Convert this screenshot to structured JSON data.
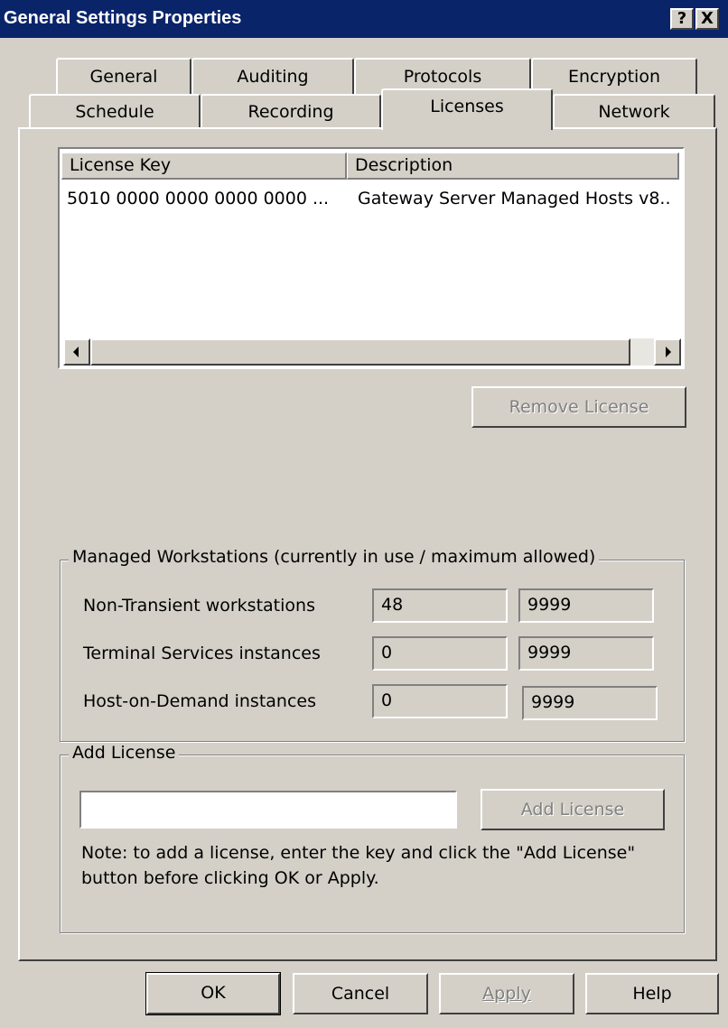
{
  "window": {
    "title": "General Settings Properties",
    "help_button": "?",
    "close_button": "X"
  },
  "tabs": {
    "row1": [
      "General",
      "Auditing",
      "Protocols",
      "Encryption"
    ],
    "row2": [
      "Schedule",
      "Recording",
      "Licenses",
      "Network"
    ],
    "selected": "Licenses"
  },
  "license_list": {
    "columns": [
      "License Key",
      "Description"
    ],
    "rows": [
      [
        "5010 0000 0000 0000 0000 ...",
        "Gateway Server Managed Hosts v8.."
      ]
    ]
  },
  "remove_license_label": "Remove License",
  "managed": {
    "legend": "Managed Workstations (currently in use / maximum allowed)",
    "rows": [
      {
        "label": "Non-Transient workstations",
        "in_use": "48",
        "max": "9999"
      },
      {
        "label": "Terminal Services instances",
        "in_use": "0",
        "max": "9999"
      },
      {
        "label": "Host-on-Demand instances",
        "in_use": "0",
        "max": "9999"
      }
    ]
  },
  "add_license": {
    "legend": "Add License",
    "input_value": "",
    "button_label": "Add License",
    "note_line1": "Note: to add a license, enter the key and click the \"Add License\"",
    "note_line2": "button before clicking OK or Apply."
  },
  "buttons": {
    "ok": "OK",
    "cancel": "Cancel",
    "apply": "Apply",
    "help": "Help"
  },
  "colors": {
    "titlebar": "#0a246a",
    "face": "#d4d0c8",
    "disabled_text": "#808080"
  },
  "icons": [
    "help-icon",
    "close-icon",
    "scroll-left-icon",
    "scroll-right-icon"
  ]
}
